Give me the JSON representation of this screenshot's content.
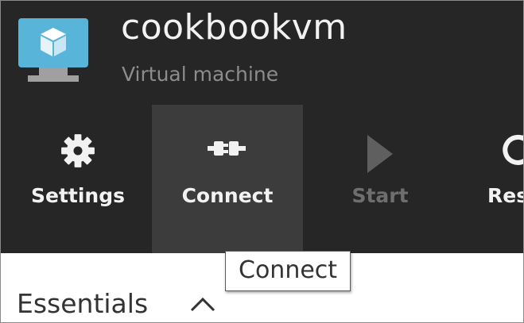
{
  "resource": {
    "title": "cookbookvm",
    "type_label": "Virtual machine",
    "icon": "virtual-machine-icon"
  },
  "commands": [
    {
      "label": "Settings",
      "icon": "gear-icon",
      "enabled": true,
      "hovered": false
    },
    {
      "label": "Connect",
      "icon": "connect-plug-icon",
      "enabled": true,
      "hovered": true
    },
    {
      "label": "Start",
      "icon": "play-icon",
      "enabled": false,
      "hovered": false
    },
    {
      "label": "Res",
      "icon": "restart-icon",
      "enabled": true,
      "hovered": false
    }
  ],
  "tooltip": {
    "text": "Connect"
  },
  "essentials": {
    "heading": "Essentials",
    "toggle_icon": "chevron-up-icon"
  },
  "colors": {
    "header_background": "#262626",
    "hover_background": "#3c3c3c",
    "vm_icon_blue": "#59b4d9",
    "disabled_text": "#6e6e6e"
  }
}
